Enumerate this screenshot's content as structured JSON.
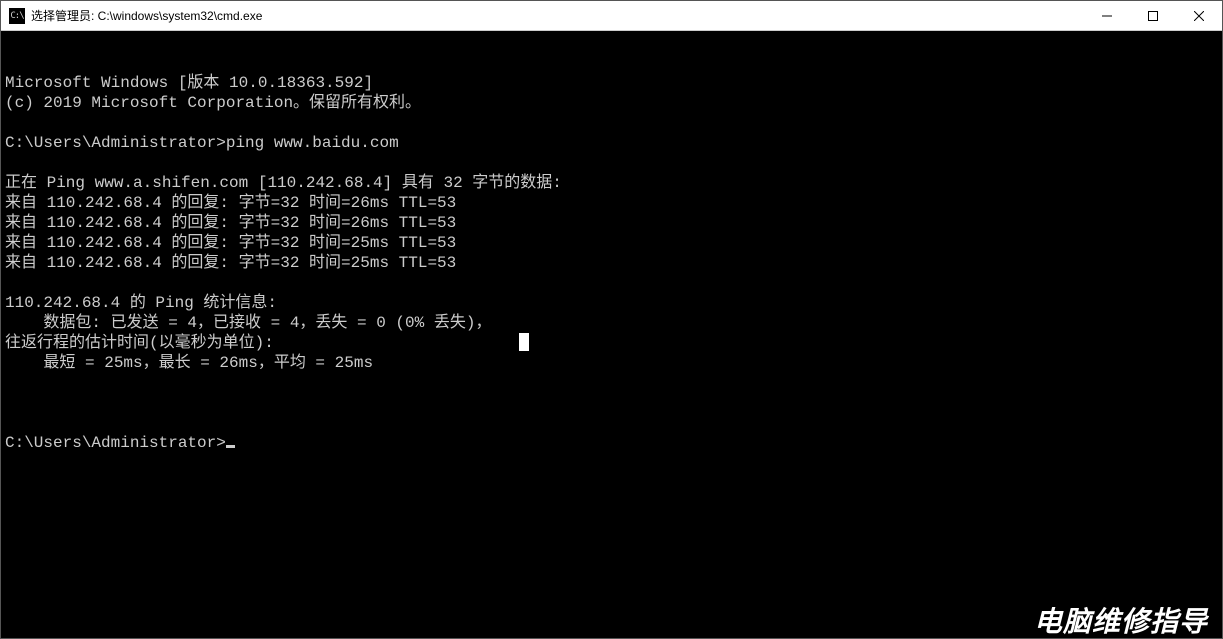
{
  "window": {
    "icon_text": "C:\\",
    "title": "选择管理员: C:\\windows\\system32\\cmd.exe"
  },
  "terminal": {
    "lines": [
      "Microsoft Windows [版本 10.0.18363.592]",
      "(c) 2019 Microsoft Corporation。保留所有权利。",
      "",
      "C:\\Users\\Administrator>ping www.baidu.com",
      "",
      "正在 Ping www.a.shifen.com [110.242.68.4] 具有 32 字节的数据:",
      "来自 110.242.68.4 的回复: 字节=32 时间=26ms TTL=53",
      "来自 110.242.68.4 的回复: 字节=32 时间=26ms TTL=53",
      "来自 110.242.68.4 的回复: 字节=32 时间=25ms TTL=53",
      "来自 110.242.68.4 的回复: 字节=32 时间=25ms TTL=53",
      "",
      "110.242.68.4 的 Ping 统计信息:",
      "    数据包: 已发送 = 4，已接收 = 4，丢失 = 0 (0% 丢失)，",
      "往返行程的估计时间(以毫秒为单位):",
      "    最短 = 25ms，最长 = 26ms，平均 = 25ms",
      ""
    ],
    "prompt": "C:\\Users\\Administrator>"
  },
  "watermark": "电脑维修指导"
}
